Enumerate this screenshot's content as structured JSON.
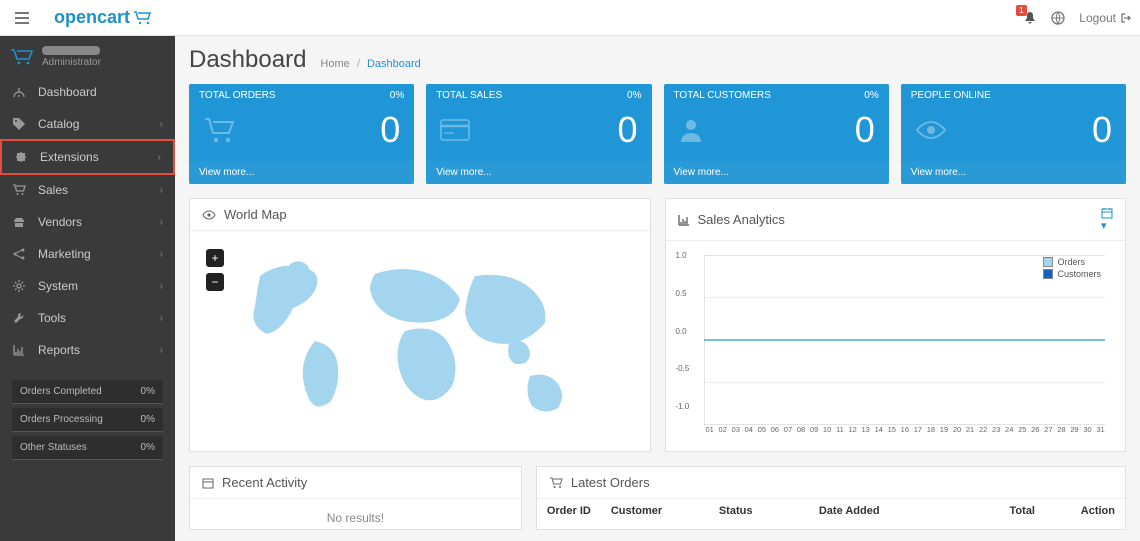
{
  "brand": "opencart",
  "notif_count": "1",
  "logout_label": "Logout",
  "user_role": "Administrator",
  "page_title": "Dashboard",
  "breadcrumb": {
    "home": "Home",
    "current": "Dashboard"
  },
  "nav": [
    {
      "icon": "dashboard",
      "label": "Dashboard",
      "expandable": false,
      "highlight": false
    },
    {
      "icon": "tag",
      "label": "Catalog",
      "expandable": true,
      "highlight": false
    },
    {
      "icon": "puzzle",
      "label": "Extensions",
      "expandable": true,
      "highlight": true
    },
    {
      "icon": "cart",
      "label": "Sales",
      "expandable": true,
      "highlight": false
    },
    {
      "icon": "vendors",
      "label": "Vendors",
      "expandable": true,
      "highlight": false
    },
    {
      "icon": "share",
      "label": "Marketing",
      "expandable": true,
      "highlight": false
    },
    {
      "icon": "gear",
      "label": "System",
      "expandable": true,
      "highlight": false
    },
    {
      "icon": "wrench",
      "label": "Tools",
      "expandable": true,
      "highlight": false
    },
    {
      "icon": "chart",
      "label": "Reports",
      "expandable": true,
      "highlight": false
    }
  ],
  "sidebar_stats": [
    {
      "label": "Orders Completed",
      "value": "0%"
    },
    {
      "label": "Orders Processing",
      "value": "0%"
    },
    {
      "label": "Other Statuses",
      "value": "0%"
    }
  ],
  "cards": [
    {
      "title": "TOTAL ORDERS",
      "pct": "0%",
      "value": "0",
      "footer": "View more...",
      "icon": "cart"
    },
    {
      "title": "TOTAL SALES",
      "pct": "0%",
      "value": "0",
      "footer": "View more...",
      "icon": "card"
    },
    {
      "title": "TOTAL CUSTOMERS",
      "pct": "0%",
      "value": "0",
      "footer": "View more...",
      "icon": "person"
    },
    {
      "title": "PEOPLE ONLINE",
      "pct": "",
      "value": "0",
      "footer": "View more...",
      "icon": "eye"
    }
  ],
  "world_map_title": "World Map",
  "analytics": {
    "title": "Sales Analytics",
    "legend": [
      "Orders",
      "Customers"
    ],
    "y_ticks": [
      "1.0",
      "0.5",
      "0.0",
      "-0.5",
      "-1.0"
    ],
    "x_ticks": [
      "01",
      "02",
      "03",
      "04",
      "05",
      "06",
      "07",
      "08",
      "09",
      "10",
      "11",
      "12",
      "13",
      "14",
      "15",
      "16",
      "17",
      "18",
      "19",
      "20",
      "21",
      "22",
      "23",
      "24",
      "25",
      "26",
      "27",
      "28",
      "29",
      "30",
      "31"
    ]
  },
  "chart_data": {
    "type": "line",
    "title": "Sales Analytics",
    "xlabel": "",
    "ylabel": "",
    "ylim": [
      -1.0,
      1.0
    ],
    "x": [
      "01",
      "02",
      "03",
      "04",
      "05",
      "06",
      "07",
      "08",
      "09",
      "10",
      "11",
      "12",
      "13",
      "14",
      "15",
      "16",
      "17",
      "18",
      "19",
      "20",
      "21",
      "22",
      "23",
      "24",
      "25",
      "26",
      "27",
      "28",
      "29",
      "30",
      "31"
    ],
    "series": [
      {
        "name": "Orders",
        "color": "#9ed4f0",
        "values": [
          0,
          0,
          0,
          0,
          0,
          0,
          0,
          0,
          0,
          0,
          0,
          0,
          0,
          0,
          0,
          0,
          0,
          0,
          0,
          0,
          0,
          0,
          0,
          0,
          0,
          0,
          0,
          0,
          0,
          0,
          0
        ]
      },
      {
        "name": "Customers",
        "color": "#1560bd",
        "values": [
          0,
          0,
          0,
          0,
          0,
          0,
          0,
          0,
          0,
          0,
          0,
          0,
          0,
          0,
          0,
          0,
          0,
          0,
          0,
          0,
          0,
          0,
          0,
          0,
          0,
          0,
          0,
          0,
          0,
          0,
          0
        ]
      }
    ]
  },
  "recent_activity": {
    "title": "Recent Activity",
    "empty": "No results!"
  },
  "latest_orders": {
    "title": "Latest Orders",
    "columns": [
      "Order ID",
      "Customer",
      "Status",
      "Date Added",
      "Total",
      "Action"
    ]
  }
}
